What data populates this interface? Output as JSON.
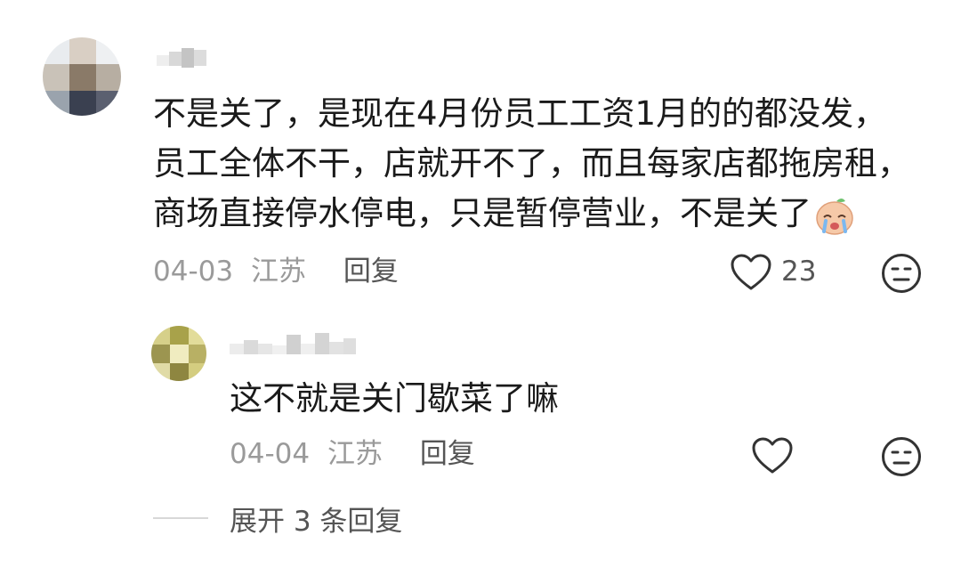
{
  "comment": {
    "lines": [
      "不是关了，是现在4月份员工工资1月的的都没发，",
      "员工全体不干，店就开不了，而且每家店都拖房租，",
      "商场直接停水停电，只是暂停营业，不是关了"
    ],
    "emoji": "crying-face-emoji",
    "date": "04-03",
    "location": "江苏",
    "reply_label": "回复",
    "like_count": "23"
  },
  "reply": {
    "text": "这不就是关门歇菜了嘛",
    "date": "04-04",
    "location": "江苏",
    "reply_label": "回复"
  },
  "expand_label": "展开 3 条回复",
  "colors": {
    "text": "#1a1a1a",
    "meta": "#9a9a9a",
    "action": "#555555",
    "icon": "#333333"
  }
}
